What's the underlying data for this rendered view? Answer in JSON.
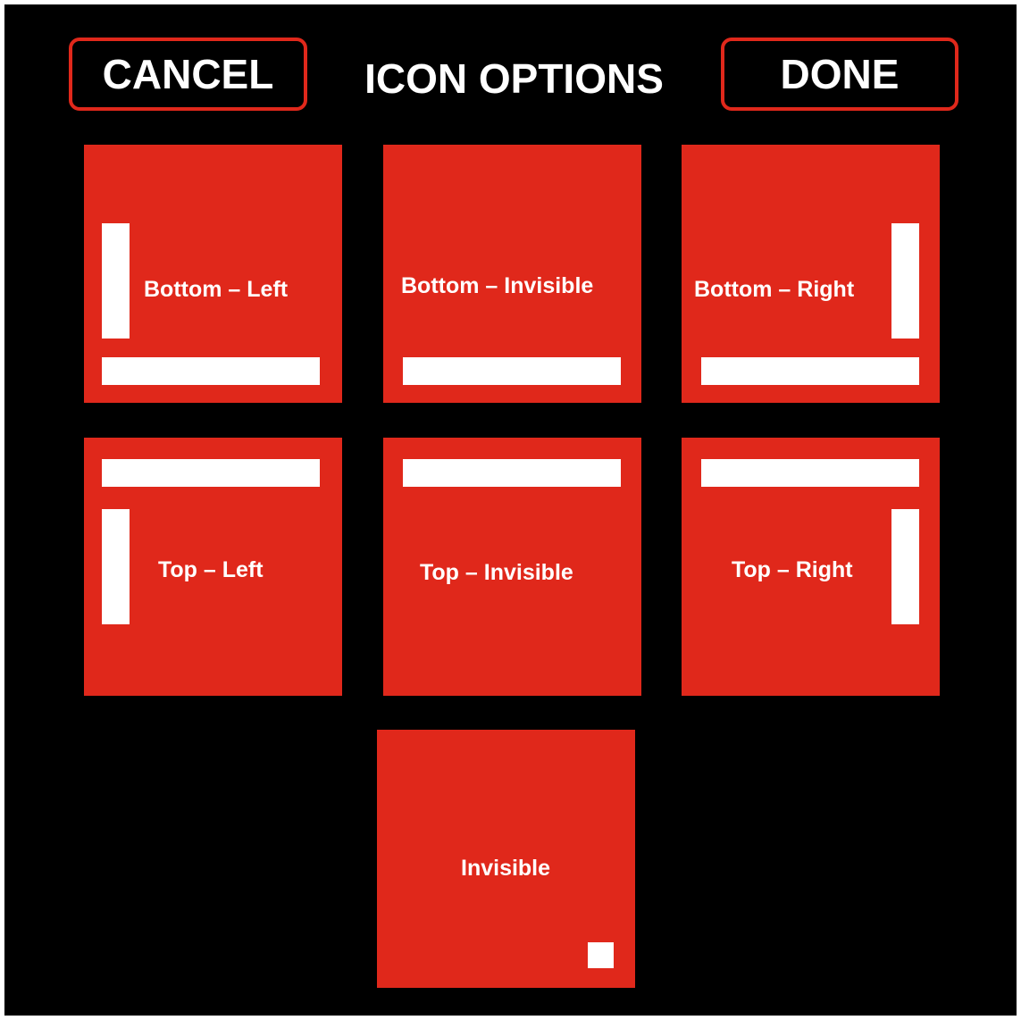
{
  "header": {
    "cancel_label": "CANCEL",
    "title": "ICON OPTIONS",
    "done_label": "DONE"
  },
  "tiles": [
    {
      "label": "Bottom – Left"
    },
    {
      "label": "Bottom – Invisible"
    },
    {
      "label": "Bottom – Right"
    },
    {
      "label": "Top – Left"
    },
    {
      "label": "Top – Invisible"
    },
    {
      "label": "Top – Right"
    },
    {
      "label": "Invisible"
    }
  ],
  "colors": {
    "background": "#000000",
    "accent": "#e0281b",
    "foreground": "#ffffff"
  },
  "icons": [
    "horizontal-bar-icon",
    "vertical-bar-icon",
    "small-square-icon"
  ]
}
